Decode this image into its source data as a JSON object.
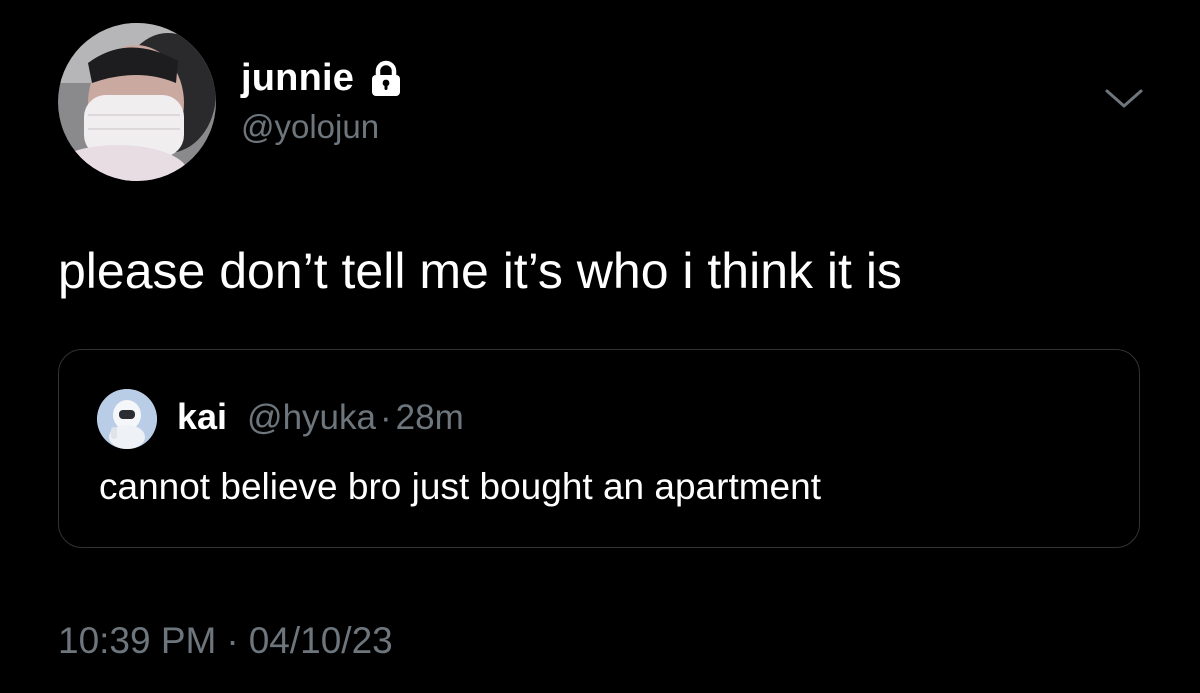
{
  "author": {
    "display_name": "junnie",
    "handle": "@yolojun",
    "protected_icon": "lock-icon",
    "avatar_icon": "profile-photo"
  },
  "menu_icon": "chevron-down-icon",
  "tweet": {
    "text": "please don’t tell me it’s who i think it is"
  },
  "quoted_tweet": {
    "display_name": "kai",
    "handle": "@hyuka",
    "separator": "·",
    "time": "28m",
    "text": "cannot believe bro just bought an apartment",
    "avatar_icon": "profile-photo"
  },
  "meta": {
    "time": "10:39 PM",
    "separator": "·",
    "date": "04/10/23"
  },
  "colors": {
    "background": "#000000",
    "primary_text": "#ffffff",
    "secondary_text": "#6e767d",
    "border": "#2f3336"
  }
}
